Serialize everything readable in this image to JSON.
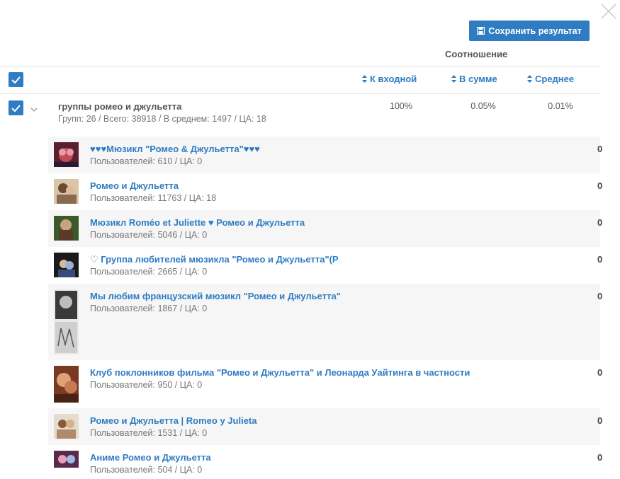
{
  "header": {
    "save_label": "Сохранить результат",
    "ratio_title": "Соотношение",
    "columns": {
      "to_input": "К входной",
      "in_total": "В сумме",
      "average": "Среднее"
    }
  },
  "group": {
    "name": "группы ромео и джульетта",
    "stats": "Групп: 26 / Всего: 38918 / В среднем: 1497 / ЦА: 18",
    "to_input": "100%",
    "in_total": "0.05%",
    "average": "0.01%"
  },
  "items": [
    {
      "title": "♥♥♥Мюзикл \"Ромео & Джульетта\"♥♥♥",
      "users": "Пользователей: 610 / ЦА: 0",
      "trail": "0"
    },
    {
      "title": "Ромео и Джульетта",
      "users": "Пользователей: 11763 / ЦА: 18",
      "trail": "0"
    },
    {
      "title": "Мюзикл Roméo et Juliette ♥ Ромео и Джульетта",
      "users": "Пользователей: 5046 / ЦА: 0",
      "trail": "0"
    },
    {
      "title": "♡ Группа любителей мюзикла \"Ромео и Джульетта\"(Р",
      "users": "Пользователей: 2665 / ЦА: 0",
      "trail": "0"
    },
    {
      "title": "Мы любим французский мюзикл \"Ромео и Джульетта\"",
      "users": "Пользователей: 1867 / ЦА: 0",
      "trail": "0"
    },
    {
      "title": "Клуб поклонников фильма \"Ромео и Джульетта\" и Леонарда Уайтинга в частности",
      "users": "Пользователей: 950 / ЦА: 0",
      "trail": "0"
    },
    {
      "title": "Ромео и Джульетта | Romeo y Julieta",
      "users": "Пользователей: 1531 / ЦА: 0",
      "trail": "0"
    },
    {
      "title": "Аниме Ромео и Джульетта",
      "users": "Пользователей: 504 / ЦА: 0",
      "trail": "0"
    }
  ],
  "colors": {
    "accent": "#2f7cc3",
    "row_alt": "#f6f6f6"
  },
  "icons": [
    "close-icon",
    "save-icon",
    "check-icon",
    "sort-icon",
    "chevron-down-icon"
  ]
}
